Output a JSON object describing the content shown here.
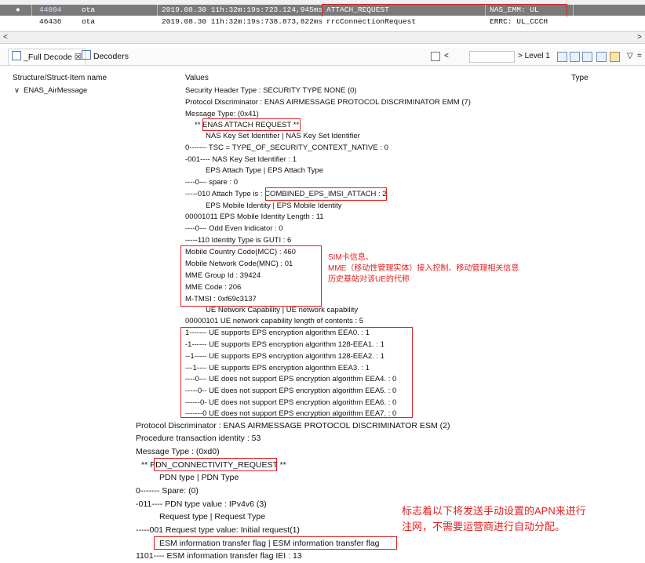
{
  "packet_table": {
    "rows": [
      {
        "bullet": "●",
        "id": "44004",
        "source": "ota",
        "time": "2019.08.30 11h:32m:19s:723.124,945ms",
        "message": "ATTACH_REQUEST",
        "channel": "NAS_EMM: UL",
        "selected": true
      },
      {
        "bullet": "",
        "id": "46436",
        "source": "ota",
        "time": "2019.08.30 11h:32m:19s:738.873,822ms",
        "message": "rrcConnectionRequest",
        "channel": "ERRC: UL_CCCH",
        "selected": false
      }
    ]
  },
  "scrollbar": {
    "left_arrow": "<",
    "right_arrow": ">"
  },
  "tabs": {
    "full_decode": "_Full Decode ☒",
    "decoders": "Decoders"
  },
  "toolbar": {
    "prev_arrow": "<",
    "level_label": "> Level 1",
    "menu_arrow": "▽",
    "minimize": "="
  },
  "columns": {
    "structure": "Structure/Struct-Item name",
    "values": "Values",
    "type": "Type"
  },
  "tree": {
    "root": "ENAS_AirMessage",
    "expander": "∨"
  },
  "decode_lines": [
    "Security Header Type : SECURITY TYPE NONE (0)",
    "Protocol Discriminator : ENAS AIRMESSAGE PROTOCOL DISCRIMINATOR EMM (7)",
    "Message Type: (0x41)",
    "** ENAS ATTACH REQUEST **",
    "NAS Key Set Identifier | NAS Key Set Identifier",
    "0------- TSC = TYPE_OF_SECURITY_CONTEXT_NATIVE : 0",
    "-001---- NAS Key Set Identifier : 1",
    "EPS Attach Type | EPS Attach Type",
    "----0--- spare : 0",
    "-----010 Attach Type is : COMBINED_EPS_IMSI_ATTACH : 2",
    "EPS Mobile Identity | EPS Mobile Identity",
    "00001011 EPS Mobile Identity Length : 11",
    "----0--- Odd Even Indicator : 0",
    "-----110 Identity Type is GUTI : 6",
    "Mobile Country Code(MCC) : 460",
    "Mobile Network Code(MNC) : 01",
    "MME Group Id : 39424",
    "MME Code : 206",
    "M-TMSI : 0xf69c3137",
    "UE Network Capability | UE network capability",
    "00000101 UE network capability length of contents : 5",
    "1------- UE supports EPS encryption algorithm EEA0. : 1",
    "-1------ UE supports EPS encryption algorithm 128-EEA1. : 1",
    "--1----- UE supports EPS encryption algorithm 128-EEA2. : 1",
    "---1---- UE supports EPS encryption algorithm EEA3. : 1",
    "----0--- UE does not support EPS encryption algorithm EEA4. : 0",
    "-----0-- UE does not support EPS encryption algorithm EEA5. : 0",
    "------0- UE does not support EPS encryption algorithm EEA6. : 0",
    "-------0 UE does not support EPS encryption algorithm EEA7. : 0"
  ],
  "esm_lines": [
    "Protocol Discriminator : ENAS AIRMESSAGE PROTOCOL DISCRIMINATOR ESM (2)",
    "Procedure transaction identity : 53",
    "Message Type : (0xd0)",
    "** PDN_CONNECTIVITY_REQUEST **",
    "PDN type | PDN Type",
    "0------- Spare: (0)",
    "-011---- PDN type value : IPv4v6 (3)",
    "Request type | Request Type",
    "-----001 Request type value: Initial request(1)",
    "ESM information transfer flag | ESM information transfer flag",
    "1101---- ESM information transfer flag IEI : 13"
  ],
  "annotations": {
    "sim_note": [
      "SIM卡信息、",
      "MME（移动性管理实体）接入控制、移动管理相关信息",
      "历史基站对该UE的代称"
    ],
    "apn_note": [
      "标志着以下将发送手动设置的APN来进行",
      "注网，不需要运营商进行自动分配。"
    ]
  },
  "colors": {
    "highlight": "#e02020",
    "selected_row": "#7a7a7a"
  }
}
